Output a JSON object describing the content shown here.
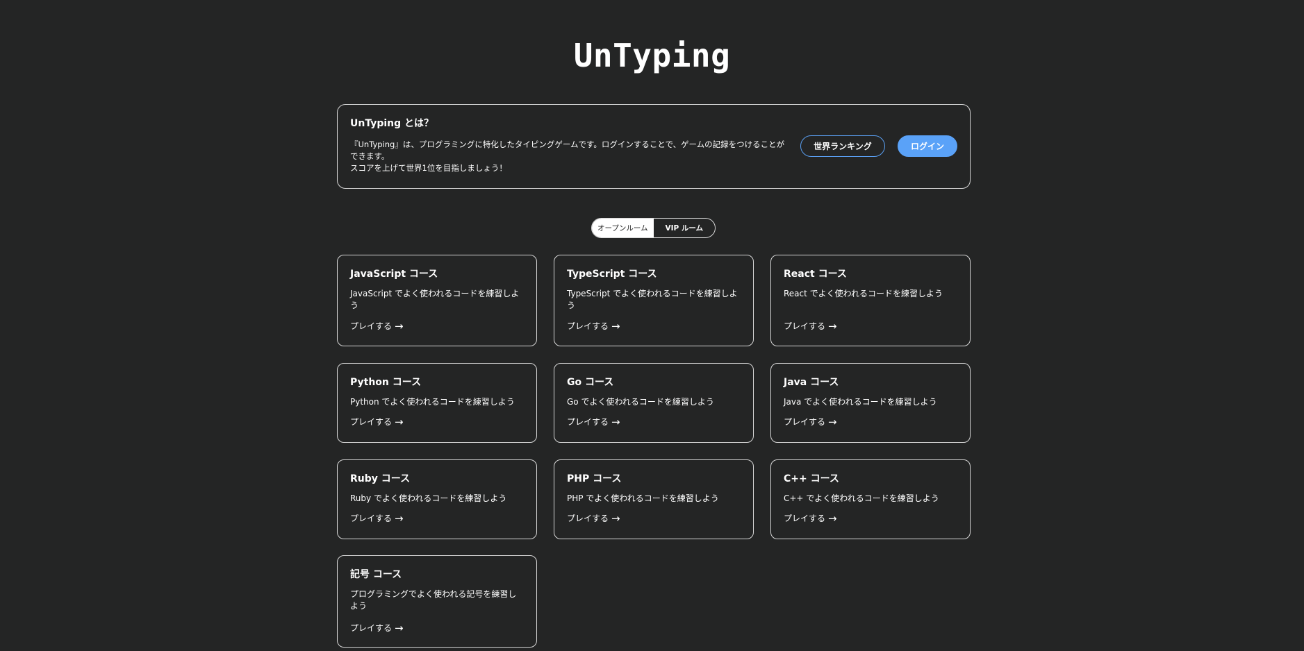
{
  "site": {
    "title": "UnTyping"
  },
  "about": {
    "heading": "UnTyping とは？",
    "line1": "『UnTyping』は、プログラミングに特化したタイピングゲームです。ログインすることで、ゲームの記録をつけることができます。",
    "line2": "スコアを上げて世界1位を目指しましょう！",
    "ranking_label": "世界ランキング",
    "login_label": "ログイン"
  },
  "rooms": {
    "open_label": "オープンルーム",
    "vip_label": "VIP ルーム",
    "selected": "オープンルーム"
  },
  "play_label": "プレイする",
  "arrow_glyph": "→",
  "courses": [
    {
      "title": "JavaScript コース",
      "desc": "JavaScript でよく使われるコードを練習しよう"
    },
    {
      "title": "TypeScript コース",
      "desc": "TypeScript でよく使われるコードを練習しよう"
    },
    {
      "title": "React コース",
      "desc": "React でよく使われるコードを練習しよう"
    },
    {
      "title": "Python コース",
      "desc": "Python でよく使われるコードを練習しよう"
    },
    {
      "title": "Go コース",
      "desc": "Go でよく使われるコードを練習しよう"
    },
    {
      "title": "Java コース",
      "desc": "Java でよく使われるコードを練習しよう"
    },
    {
      "title": "Ruby コース",
      "desc": "Ruby でよく使われるコードを練習しよう"
    },
    {
      "title": "PHP コース",
      "desc": "PHP でよく使われるコードを練習しよう"
    },
    {
      "title": "C++ コース",
      "desc": "C++ でよく使われるコードを練習しよう"
    },
    {
      "title": "記号 コース",
      "desc": "プログラミングでよく使われる記号を練習しよう"
    }
  ],
  "colors": {
    "background": "#242525",
    "border": "#d7d7d7",
    "accent": "#5aa2f8"
  }
}
